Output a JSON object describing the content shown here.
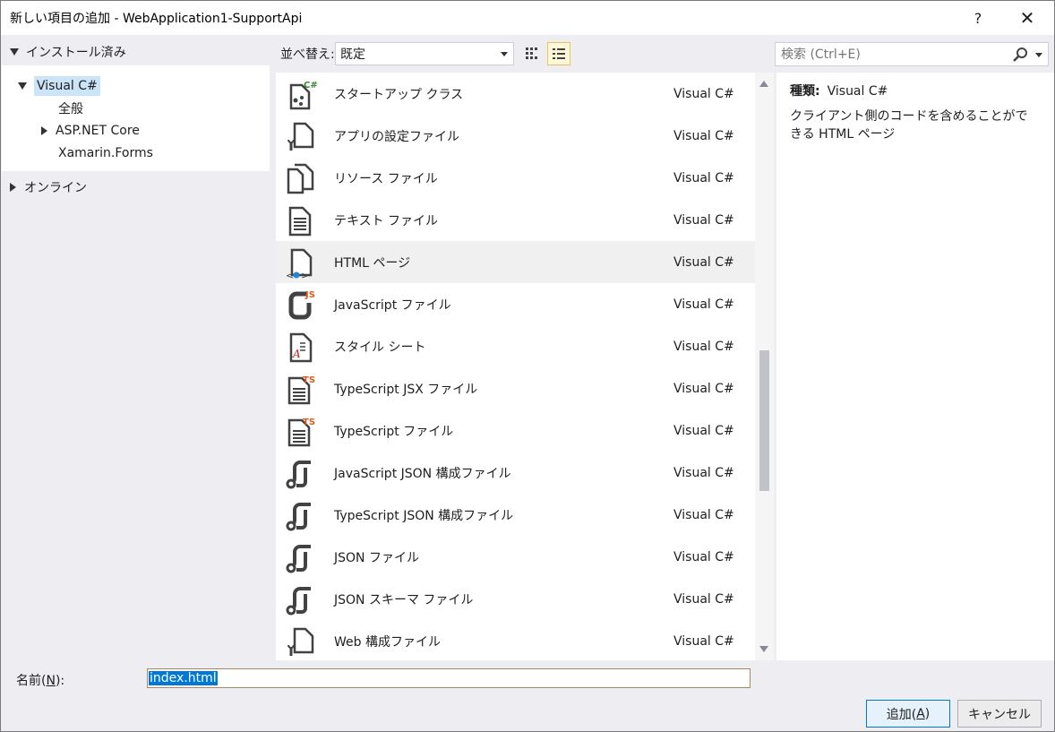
{
  "window": {
    "title": "新しい項目の追加 - WebApplication1-SupportApi",
    "help_label": "?",
    "close_label": "✕"
  },
  "tree": {
    "header": "インストール済み",
    "items": [
      {
        "label": "Visual C#",
        "selected": true
      },
      {
        "label": "全般"
      },
      {
        "label": "ASP.NET Core"
      },
      {
        "label": "Xamarin.Forms"
      }
    ],
    "online": "オンライン"
  },
  "toolbar": {
    "sort_label": "並べ替え:",
    "sort_value": "既定",
    "search_placeholder": "検索 (Ctrl+E)"
  },
  "templates": [
    {
      "name": "スタートアップ クラス",
      "lang": "Visual C#",
      "icon": "csharp-class-icon"
    },
    {
      "name": "アプリの設定ファイル",
      "lang": "Visual C#",
      "icon": "config-file-icon"
    },
    {
      "name": "リソース ファイル",
      "lang": "Visual C#",
      "icon": "resource-file-icon"
    },
    {
      "name": "テキスト ファイル",
      "lang": "Visual C#",
      "icon": "text-file-icon"
    },
    {
      "name": "HTML ページ",
      "lang": "Visual C#",
      "icon": "html-page-icon",
      "highlighted": true
    },
    {
      "name": "JavaScript ファイル",
      "lang": "Visual C#",
      "icon": "javascript-file-icon"
    },
    {
      "name": "スタイル シート",
      "lang": "Visual C#",
      "icon": "stylesheet-icon"
    },
    {
      "name": "TypeScript JSX ファイル",
      "lang": "Visual C#",
      "icon": "typescript-jsx-icon"
    },
    {
      "name": "TypeScript ファイル",
      "lang": "Visual C#",
      "icon": "typescript-file-icon"
    },
    {
      "name": "JavaScript JSON 構成ファイル",
      "lang": "Visual C#",
      "icon": "json-config-icon"
    },
    {
      "name": "TypeScript JSON 構成ファイル",
      "lang": "Visual C#",
      "icon": "json-config-icon"
    },
    {
      "name": "JSON ファイル",
      "lang": "Visual C#",
      "icon": "json-file-icon"
    },
    {
      "name": "JSON スキーマ ファイル",
      "lang": "Visual C#",
      "icon": "json-schema-icon"
    },
    {
      "name": "Web 構成ファイル",
      "lang": "Visual C#",
      "icon": "web-config-icon"
    }
  ],
  "details": {
    "type_label": "種類:",
    "type_value": "Visual C#",
    "description": "クライアント側のコードを含めることができる HTML ページ"
  },
  "bottom": {
    "name_label_pre": "名前(",
    "name_label_key": "N",
    "name_label_post": "):",
    "name_value": "index.html",
    "add_pre": "追加(",
    "add_key": "A",
    "add_post": ")",
    "cancel_label": "キャンセル"
  },
  "colors": {
    "selection": "#cce4f7",
    "accent": "#0078d7",
    "ts_orange": "#e25b1b",
    "csharp_green": "#388a34"
  }
}
